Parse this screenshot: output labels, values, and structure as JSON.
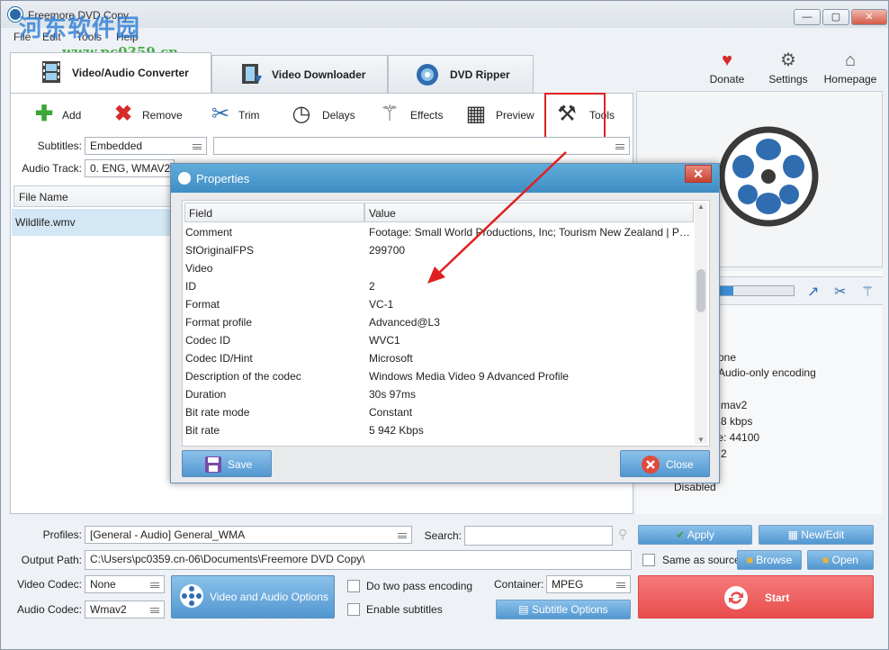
{
  "window": {
    "title": "Freemore DVD Copy",
    "minimize": "—",
    "maximize": "▢",
    "close": "✕"
  },
  "watermark": {
    "brand": "河东软件园",
    "url": "www.pc0359.cn"
  },
  "menu": [
    "File",
    "Edit",
    "Tools",
    "Help"
  ],
  "tabs": [
    {
      "label": "Video/Audio Converter",
      "icon": "film-icon"
    },
    {
      "label": "Video Downloader",
      "icon": "download-film-icon"
    },
    {
      "label": "DVD Ripper",
      "icon": "disc-icon"
    }
  ],
  "top_actions": [
    {
      "label": "Donate",
      "icon": "heart-icon"
    },
    {
      "label": "Settings",
      "icon": "gear-icon"
    },
    {
      "label": "Homepage",
      "icon": "home-icon"
    }
  ],
  "toolbar": [
    {
      "label": "Add",
      "icon": "plus-icon"
    },
    {
      "label": "Remove",
      "icon": "x-icon"
    },
    {
      "label": "Trim",
      "icon": "scissors-icon"
    },
    {
      "label": "Delays",
      "icon": "clock-icon"
    },
    {
      "label": "Effects",
      "icon": "magic-wand-icon"
    },
    {
      "label": "Preview",
      "icon": "film-preview-icon"
    },
    {
      "label": "Tools",
      "icon": "tools-icon"
    }
  ],
  "subtitles": {
    "label": "Subtitles:",
    "value": "Embedded",
    "extra": ""
  },
  "audio_track": {
    "label": "Audio Track:",
    "value": "0. ENG, WMAV2 ("
  },
  "file_list": {
    "header": "File Name",
    "rows": [
      "Wildlife.wmv"
    ]
  },
  "preview": {
    "progress": 0.25,
    "info_lines": [
      "one",
      "Audio-only encoding",
      "",
      "mav2",
      "8 kbps",
      "te: 44100",
      "2",
      "Disabled"
    ]
  },
  "dialog": {
    "title": "Properties",
    "close": "✕",
    "columns": {
      "field": "Field",
      "value": "Value"
    },
    "rows": [
      {
        "field": "Comment",
        "value": "Footage: Small World Productions, Inc; Tourism New Zealand | Pro..."
      },
      {
        "field": "SfOriginalFPS",
        "value": "299700"
      },
      {
        "field": "Video",
        "value": ""
      },
      {
        "field": "ID",
        "value": "2"
      },
      {
        "field": "Format",
        "value": "VC-1"
      },
      {
        "field": "Format profile",
        "value": "Advanced@L3"
      },
      {
        "field": "Codec ID",
        "value": "WVC1"
      },
      {
        "field": "Codec ID/Hint",
        "value": "Microsoft"
      },
      {
        "field": "Description of the codec",
        "value": "Windows Media Video 9 Advanced Profile"
      },
      {
        "field": "Duration",
        "value": "30s 97ms"
      },
      {
        "field": "Bit rate mode",
        "value": "Constant"
      },
      {
        "field": "Bit rate",
        "value": "5 942 Kbps"
      }
    ],
    "save": "Save",
    "close_btn": "Close"
  },
  "bottom": {
    "profiles_label": "Profiles:",
    "profiles_value": "[General - Audio] General_WMA",
    "search_label": "Search:",
    "search_value": "",
    "apply": "Apply",
    "new_edit": "New/Edit",
    "output_label": "Output Path:",
    "output_value": "C:\\Users\\pc0359.cn-06\\Documents\\Freemore DVD Copy\\",
    "same_as_source": "Same as source",
    "browse": "Browse",
    "open": "Open",
    "video_codec_label": "Video Codec:",
    "video_codec_value": "None",
    "audio_codec_label": "Audio Codec:",
    "audio_codec_value": "Wmav2",
    "va_options": "Video and Audio Options",
    "two_pass": "Do two pass encoding",
    "enable_subtitles": "Enable subtitles",
    "container_label": "Container:",
    "container_value": "MPEG",
    "subtitle_options": "Subtitle Options",
    "start": "Start"
  },
  "colors": {
    "accent_blue": "#3e8dc4",
    "start_red": "#e94d4d",
    "highlight_red": "#e02020"
  }
}
